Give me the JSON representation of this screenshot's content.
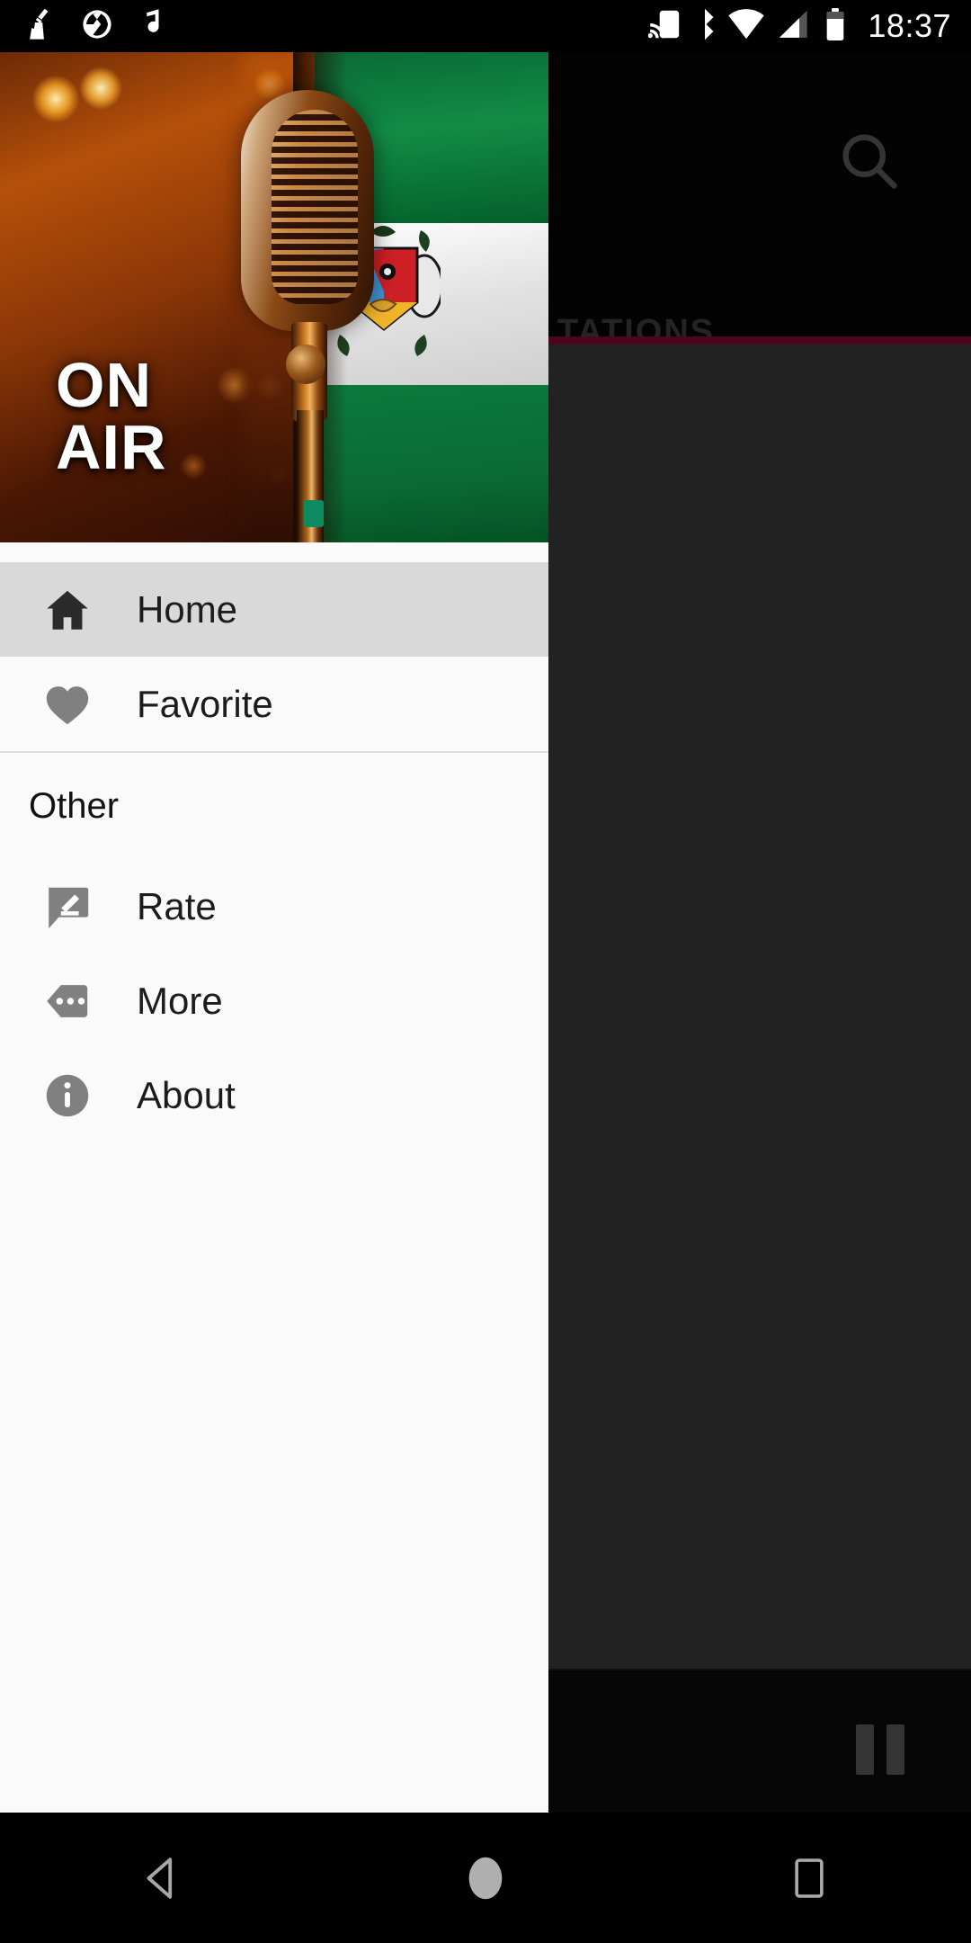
{
  "status_bar": {
    "time": "18:37",
    "left_icons": [
      "cleaner-icon",
      "camera-aperture-icon",
      "music-note-icon"
    ],
    "right_icons": [
      "cast-icon",
      "bluetooth-icon",
      "wifi-icon",
      "cellular-signal-icon",
      "battery-icon"
    ],
    "background": "#000000"
  },
  "app": {
    "toolbar": {
      "search_icon": "search-icon",
      "background": "#090909"
    },
    "tabs": {
      "visible_label": "TATIONS",
      "full_label": "STATIONS",
      "indicator_color": "#bf1150"
    },
    "player": {
      "pause_icon": "pause-icon"
    },
    "scrim_color": "rgba(0,0,0,0.62)"
  },
  "drawer": {
    "header": {
      "on_air_line1": "ON",
      "on_air_line2": "AIR",
      "image_description": "vintage-microphone-and-nigerian-flag"
    },
    "primary_items": [
      {
        "label": "Home",
        "icon": "home-icon",
        "selected": true
      },
      {
        "label": "Favorite",
        "icon": "heart-icon",
        "selected": false
      }
    ],
    "section_label": "Other",
    "other_items": [
      {
        "label": "Rate",
        "icon": "rate-edit-icon"
      },
      {
        "label": "More",
        "icon": "more-dots-icon"
      },
      {
        "label": "About",
        "icon": "info-icon"
      }
    ],
    "background": "#fafafa",
    "selected_background": "#d9d9d9"
  },
  "nav_bar": {
    "buttons": [
      {
        "name": "back-button",
        "icon": "back-triangle-icon"
      },
      {
        "name": "home-button",
        "icon": "home-circle-icon"
      },
      {
        "name": "recents-button",
        "icon": "recents-square-icon"
      }
    ]
  }
}
